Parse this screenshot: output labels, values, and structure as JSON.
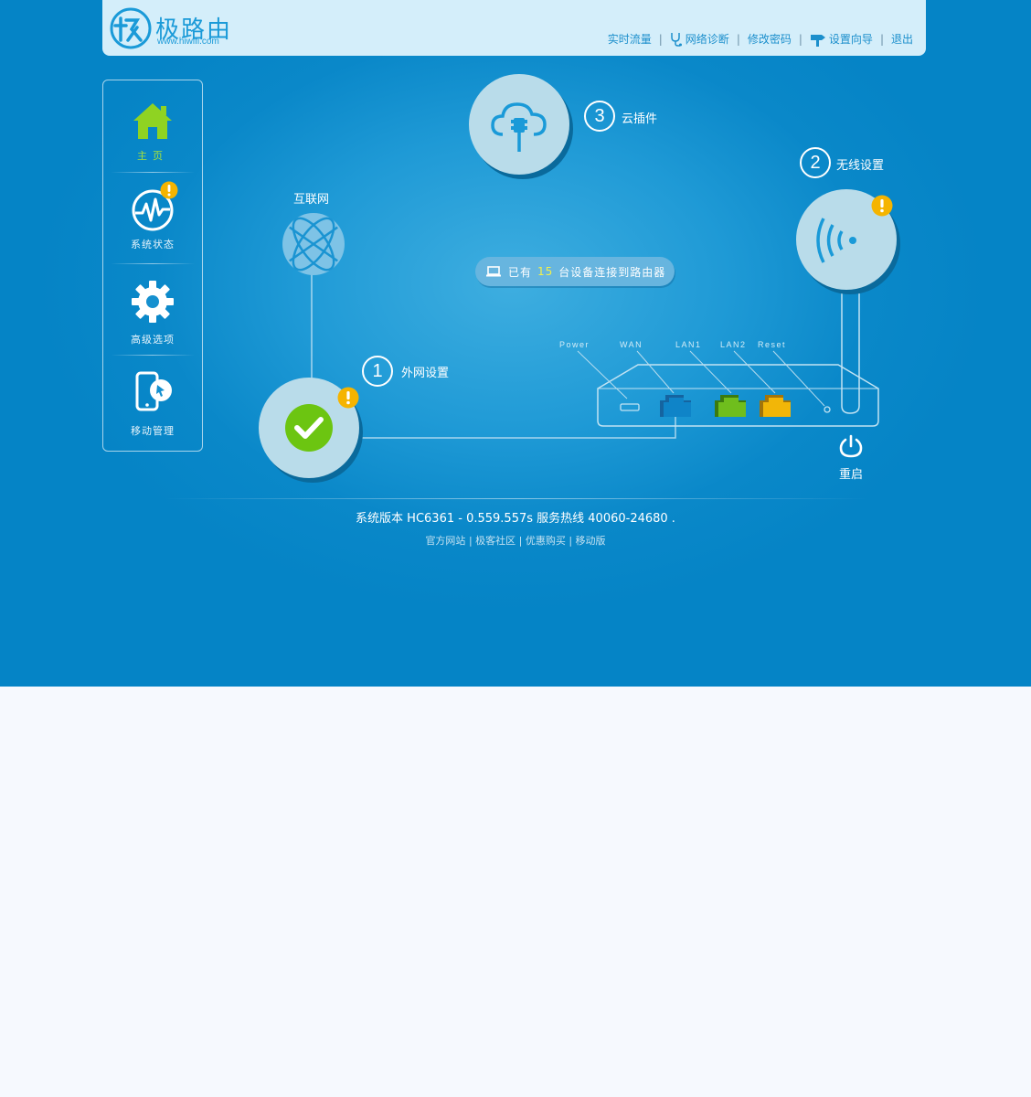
{
  "header": {
    "logo_text": "极路由",
    "logo_url": "www.hiwifi.com",
    "nav": {
      "traffic": "实时流量",
      "diagnose": "网络诊断",
      "password": "修改密码",
      "wizard": "设置向导",
      "logout": "退出"
    }
  },
  "sidebar": {
    "items": [
      {
        "label": "主页",
        "icon": "home-icon",
        "active": true
      },
      {
        "label": "系统状态",
        "icon": "pulse-icon",
        "warning": true
      },
      {
        "label": "高级选项",
        "icon": "gear-icon"
      },
      {
        "label": "移动管理",
        "icon": "mobile-icon"
      }
    ]
  },
  "diagram": {
    "internet_label": "互联网",
    "wan": {
      "number": "1",
      "label": "外网设置",
      "warning": true
    },
    "wireless": {
      "number": "2",
      "label": "无线设置",
      "warning": true
    },
    "cloud": {
      "number": "3",
      "label": "云插件"
    },
    "devices": {
      "prefix": "已有",
      "count": "15",
      "suffix": "台设备连接到路由器"
    },
    "ports": {
      "power": "Power",
      "wan": "WAN",
      "lan1": "LAN1",
      "lan2": "LAN2",
      "reset": "Reset"
    },
    "restart_label": "重启"
  },
  "footer": {
    "version": "系统版本 HC6361 - 0.559.557s 服务热线 40060-24680 .",
    "links": {
      "official": "官方网站",
      "community": "极客社区",
      "shop": "优惠购买",
      "mobile": "移动版"
    }
  },
  "colors": {
    "background": "#0584c6",
    "header": "#d4eefa",
    "accent_green": "#8fd322",
    "warning": "#f5b400",
    "port_wan": "#0f84c8",
    "port_lan1": "#6fbe1d",
    "port_lan2": "#f2b608"
  }
}
